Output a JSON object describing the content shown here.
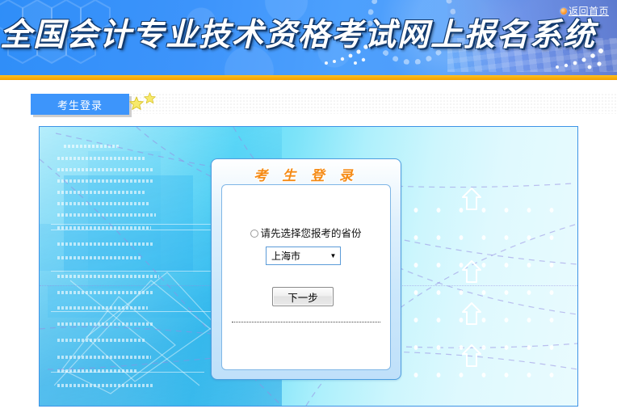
{
  "banner": {
    "title": "全国会计专业技术资格考试网上报名系统",
    "home_link": "返回首页",
    "home_dot_icon": "orange-bullet-icon",
    "bg_color": "#3d94fb",
    "rule_color": "#f2a000"
  },
  "tabs": [
    {
      "label": "考生登录",
      "active": true,
      "color": "#3d95fb"
    }
  ],
  "decor": {
    "star_icon": "star-icon",
    "star_color": "#f5e15c",
    "arrow_icon": "up-arrow-icon"
  },
  "login_panel": {
    "title": "考 生 登 录",
    "title_color": "#f58b16",
    "prompt": "请先选择您报考的省份",
    "radio_icon": "radio-circle-icon",
    "province_select": {
      "value": "上海市",
      "arrow_icon": "chevron-down-icon",
      "options": [
        "上海市"
      ]
    },
    "next_button": "下一步"
  }
}
